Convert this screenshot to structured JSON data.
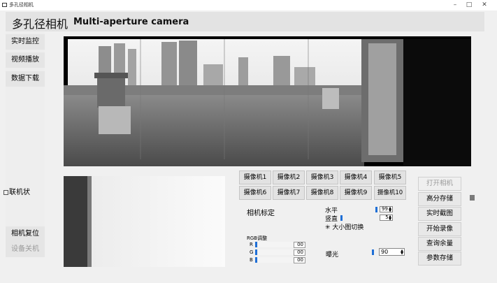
{
  "window": {
    "title": "多孔径相机",
    "minimize": "–",
    "maximize": "□",
    "close": "✕"
  },
  "header": {
    "title_zh": "多孔径相机",
    "title_en": "Multi-aperture camera"
  },
  "nav": {
    "monitor": "实时监控",
    "playback": "视频播放",
    "download": "数据下载",
    "link_status": "联机状",
    "camera_reset": "相机复位",
    "shutdown": "设备关机"
  },
  "cameras": [
    "摄像机1",
    "摄像机2",
    "摄像机3",
    "摄像机4",
    "摄像机5",
    "摄像机6",
    "摄像机7",
    "摄像机8",
    "摄像机9",
    "摄像机10"
  ],
  "calibration": {
    "label": "相机标定",
    "horizontal_label": "水平",
    "horizontal_value": "99",
    "vertical_label": "竖直",
    "vertical_value": "5",
    "toggle_label": "大小图切换",
    "rgb_label": "RGB调整",
    "r_label": "R",
    "r_value": "00",
    "g_label": "G",
    "g_value": "00",
    "b_label": "B",
    "b_value": "00",
    "exposure_label": "曝光",
    "exposure_value": "90"
  },
  "actions": {
    "open_camera": "打开相机",
    "hires_save": "高分存储",
    "snapshot": "实时截图",
    "start_record": "开始录像",
    "query_space": "查询余量",
    "param_save": "参数存储"
  }
}
